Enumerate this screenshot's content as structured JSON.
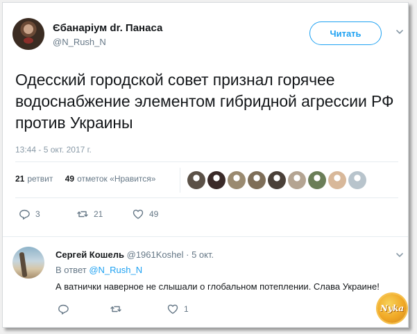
{
  "tweet": {
    "author_name": "Єбанаріум dr. Панаса",
    "author_handle": "@N_Rush_N",
    "follow_label": "Читать",
    "text": "Одесский городской совет признал горячее водоснабжение элементом гибридной агрессии РФ против Украины",
    "timestamp": "13:44 - 5 окт. 2017 г.",
    "retweets_count": "21",
    "retweets_label": "ретвит",
    "likes_count": "49",
    "likes_label": "отметок «Нравится»",
    "liker_avatars": [
      "#5b5147",
      "#3a2a28",
      "#9a8a70",
      "#7e6e58",
      "#4a4038",
      "#b4a492",
      "#6b7e58",
      "#d8b89a",
      "#b8c4cc"
    ],
    "actions": {
      "reply_count": "3",
      "retweet_count": "21",
      "like_count": "49"
    }
  },
  "reply": {
    "author_name": "Сергей Кошель",
    "author_handle": "@1961Koshel",
    "separator": "·",
    "date": "5 окт.",
    "in_reply_prefix": "В ответ",
    "in_reply_handle": "@N_Rush_N",
    "text": "А ватнички наверное не слышали о глобальном потеплении. Слава Украине!",
    "actions": {
      "reply_count": "",
      "retweet_count": "",
      "like_count": "1"
    }
  },
  "watermark": {
    "text": "Nyka"
  },
  "colors": {
    "accent": "#1da1f2",
    "muted": "#657786",
    "text": "#14171a",
    "divider": "#e6ecf0"
  },
  "icons": [
    "chevron-down-icon",
    "reply-icon",
    "retweet-icon",
    "like-icon"
  ]
}
